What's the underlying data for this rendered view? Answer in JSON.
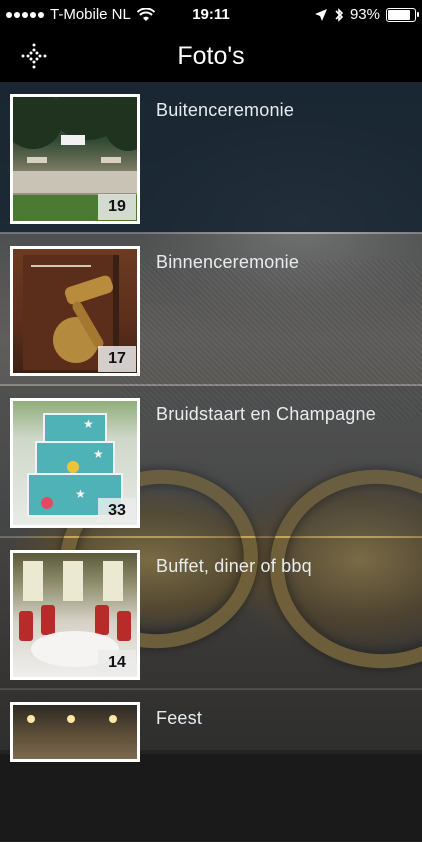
{
  "status_bar": {
    "carrier": "T-Mobile NL",
    "time": "19:11",
    "battery": "93%",
    "battery_fraction": 0.93,
    "icons": [
      "signal-dots-icon",
      "wifi-icon",
      "location-arrow-icon",
      "bluetooth-icon",
      "battery-icon"
    ]
  },
  "nav": {
    "title": "Foto's",
    "menu_icon": "dots-cross-menu-icon"
  },
  "albums": [
    {
      "label": "Buitenceremonie",
      "count": "19"
    },
    {
      "label": "Binnenceremonie",
      "count": "17"
    },
    {
      "label": "Bruidstaart en Champagne",
      "count": "33"
    },
    {
      "label": "Buffet, diner of bbq",
      "count": "14"
    },
    {
      "label": "Feest"
    }
  ],
  "colors": {
    "nav_bg": "#000000",
    "text": "#e9ecef",
    "badge_bg": "#ebebeb",
    "first_row_bg": "#162430"
  }
}
